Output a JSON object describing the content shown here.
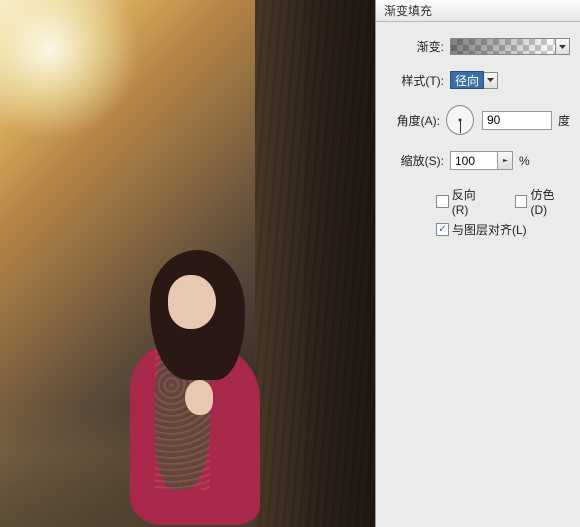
{
  "dialog": {
    "title": "渐变填充",
    "gradient": {
      "label": "渐变:"
    },
    "style": {
      "label": "样式(T):",
      "value": "径向"
    },
    "angle": {
      "label": "角度(A):",
      "value": "90",
      "unit": "度"
    },
    "scale": {
      "label": "缩放(S):",
      "value": "100",
      "unit": "%"
    },
    "checks": {
      "reverse": {
        "label": "反向(R)",
        "checked": false
      },
      "dither": {
        "label": "仿色(D)",
        "checked": false
      },
      "align": {
        "label": "与图层对齐(L)",
        "checked": true
      }
    }
  }
}
